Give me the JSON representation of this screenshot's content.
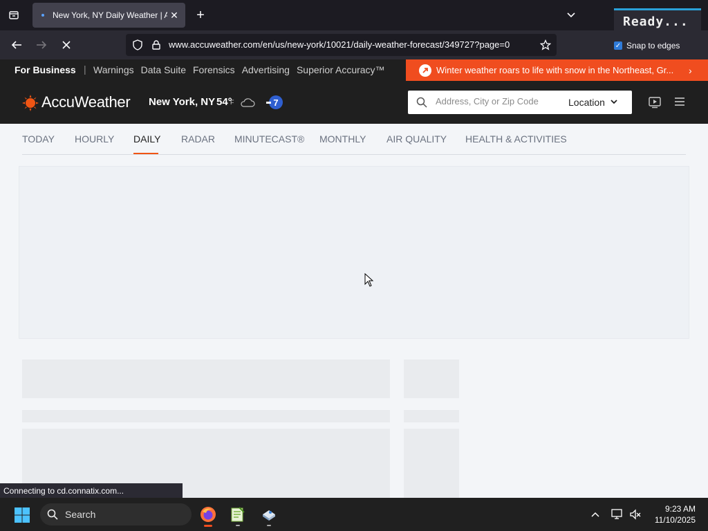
{
  "browser": {
    "tab": {
      "title": "New York, NY Daily Weather | AccuWeather"
    },
    "url": "www.accuweather.com/en/us/new-york/10021/daily-weather-forecast/349727?page=0",
    "status_text": "Connecting to cd.connatix.com...",
    "overlay_label": "Ready...",
    "snap_label": "Snap to edges"
  },
  "business_bar": {
    "title": "For Business",
    "separator": "|",
    "links": [
      "Warnings",
      "Data Suite",
      "Forensics",
      "Advertising",
      "Superior Accuracy™"
    ]
  },
  "alert": {
    "text": "Winter weather roars to life with snow in the Northeast, Gr..."
  },
  "header": {
    "logo_text": "AccuWeather",
    "location": "New York, NY",
    "temperature": "54°",
    "unit": "F",
    "search_placeholder": "Address, City or Zip Code",
    "location_button": "Location"
  },
  "subnav": {
    "items": [
      "TODAY",
      "HOURLY",
      "DAILY",
      "RADAR",
      "MINUTECAST®",
      "MONTHLY",
      "AIR QUALITY",
      "HEALTH & ACTIVITIES"
    ],
    "active": "DAILY"
  },
  "taskbar": {
    "search_label": "Search",
    "time": "9:23 AM",
    "date": "11/10/2025"
  },
  "colors": {
    "accent": "#f05514",
    "alert_bg": "#f04d1f",
    "header_bg": "#1f1f1f"
  }
}
